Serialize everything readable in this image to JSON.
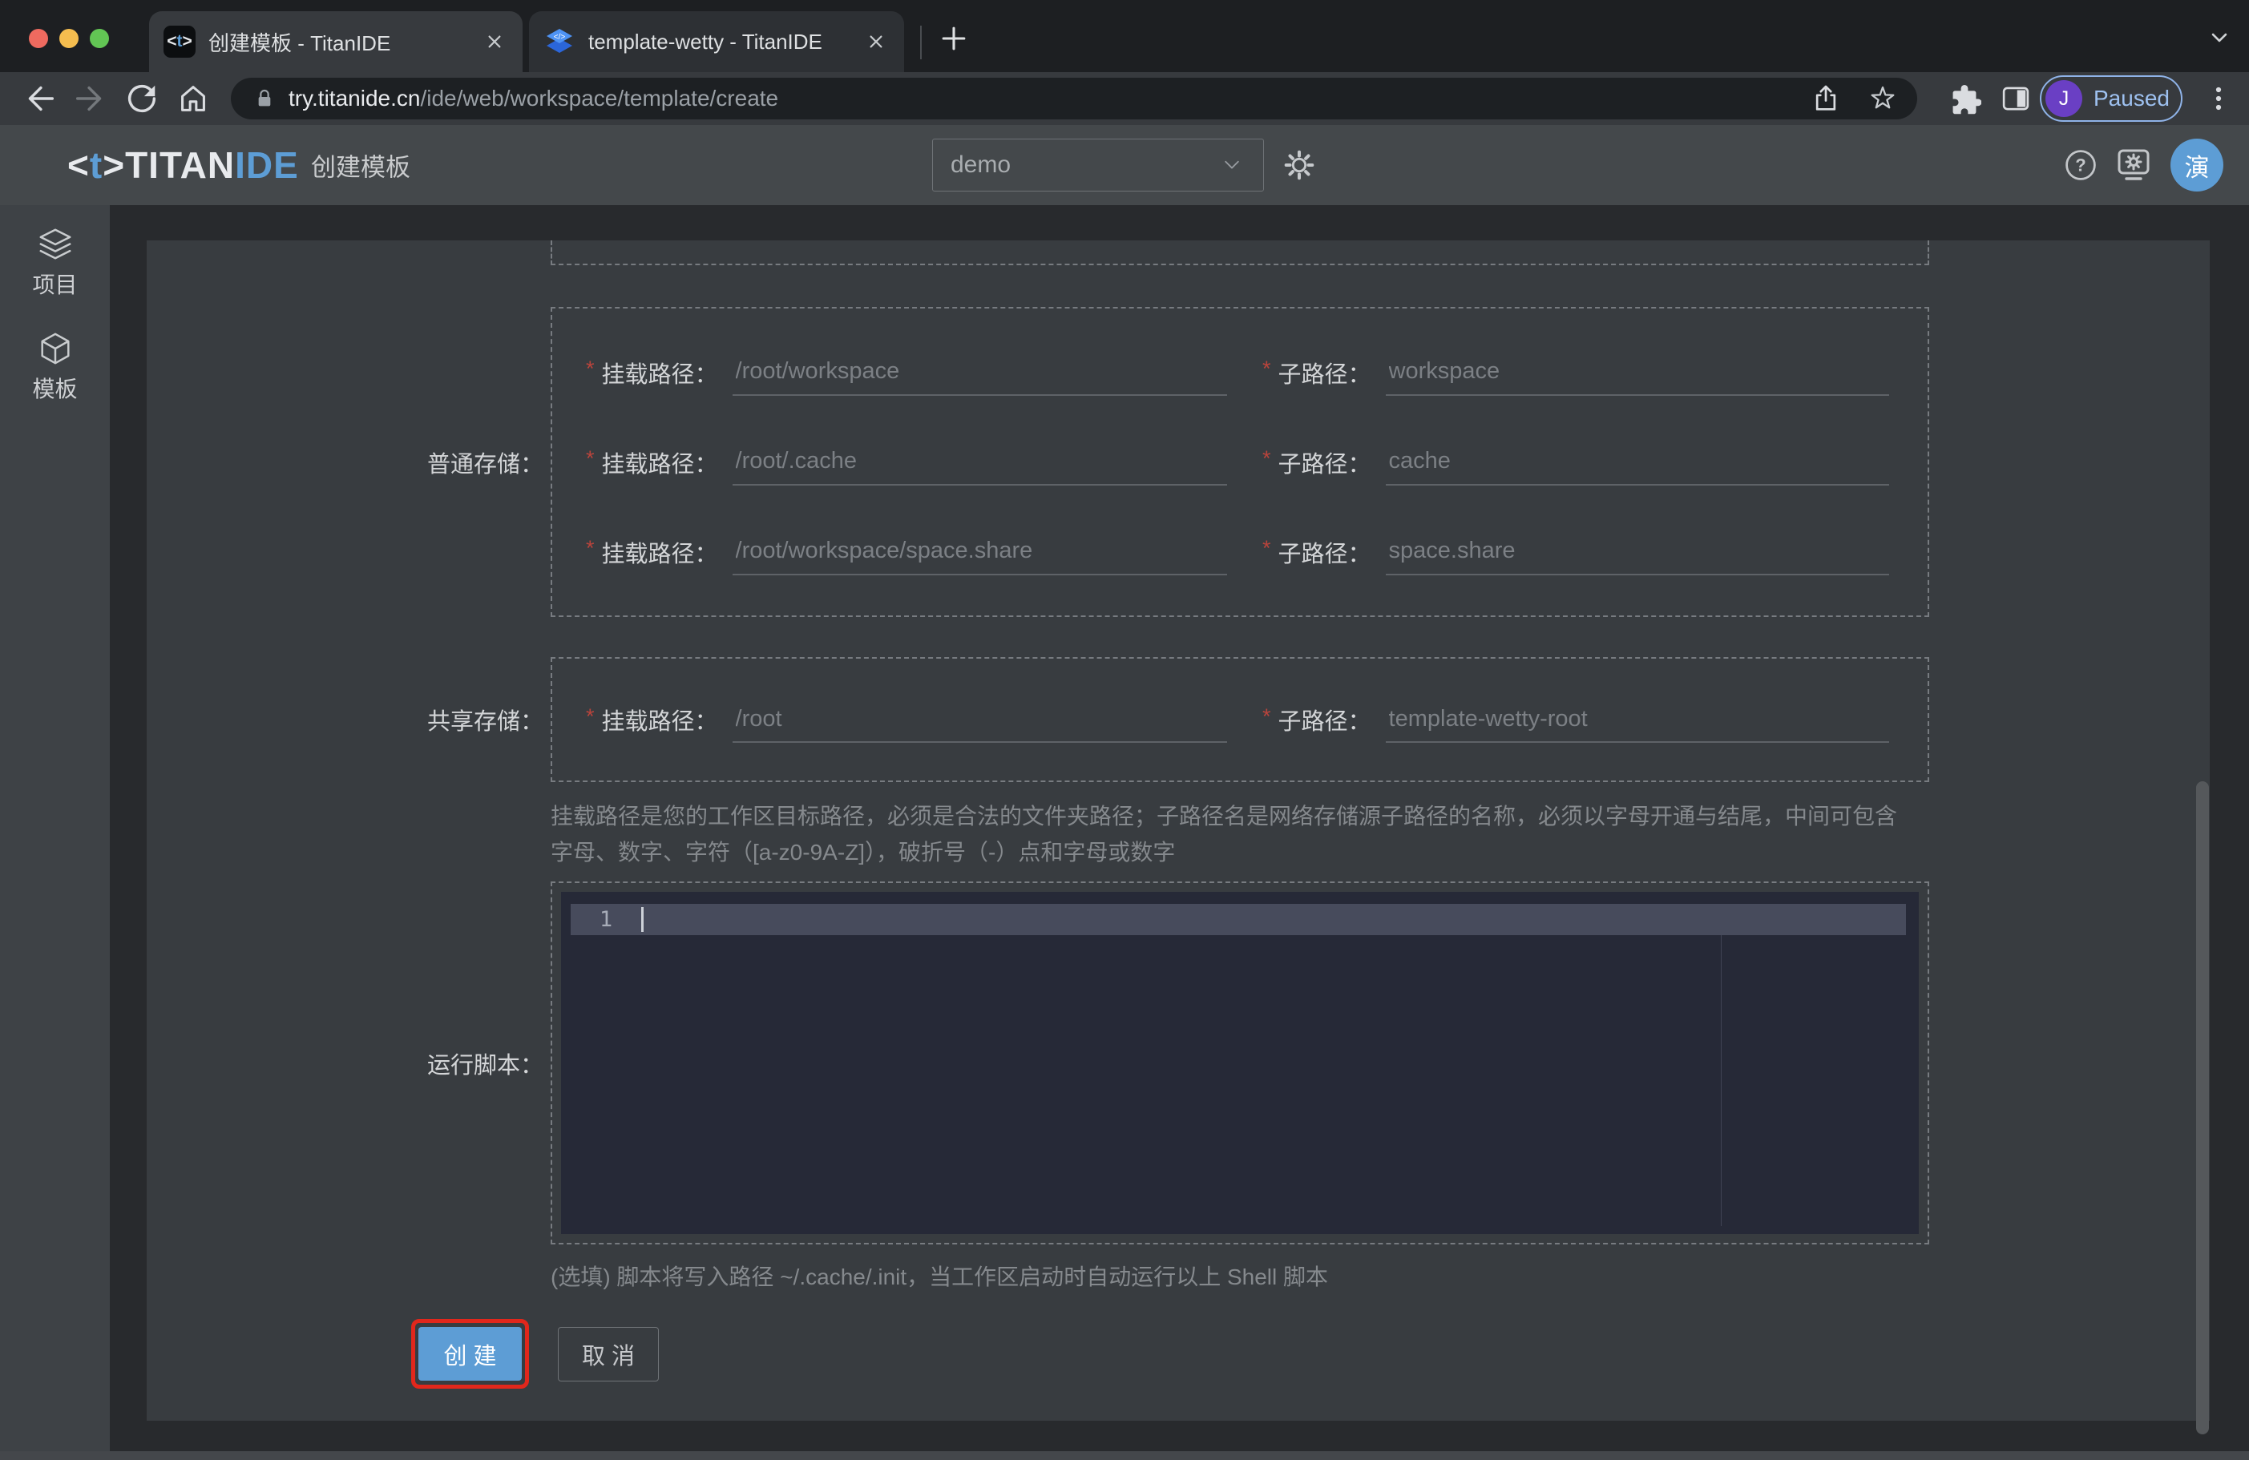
{
  "browser": {
    "tabs": [
      {
        "title": "创建模板 - TitanIDE"
      },
      {
        "title": "template-wetty - TitanIDE"
      }
    ],
    "favicon1": {
      "open": "<",
      "t": "t",
      "close": ">"
    },
    "address": {
      "host": "try.titanide.cn",
      "path": "/ide/web/workspace/template/create"
    },
    "profile": {
      "initial": "J",
      "status": "Paused"
    }
  },
  "header": {
    "logo": {
      "open": "<",
      "t": "t",
      "close": ">",
      "titan": "TITAN",
      "ide": "IDE"
    },
    "page_title": "创建模板",
    "workspace_select": {
      "value": "demo"
    },
    "help_glyph": "?",
    "avatar": "演"
  },
  "sidebar": {
    "items": [
      {
        "label": "项目"
      },
      {
        "label": "模板"
      }
    ]
  },
  "form": {
    "required_marker": "*",
    "normal_storage": {
      "label": "普通存储：",
      "rows": [
        {
          "mount_label": "挂载路径：",
          "mount_placeholder": "/root/workspace",
          "sub_label": "子路径：",
          "sub_placeholder": "workspace"
        },
        {
          "mount_label": "挂载路径：",
          "mount_placeholder": "/root/.cache",
          "sub_label": "子路径：",
          "sub_placeholder": "cache"
        },
        {
          "mount_label": "挂载路径：",
          "mount_placeholder": "/root/workspace/space.share",
          "sub_label": "子路径：",
          "sub_placeholder": "space.share"
        }
      ]
    },
    "shared_storage": {
      "label": "共享存储：",
      "rows": [
        {
          "mount_label": "挂载路径：",
          "mount_placeholder": "/root",
          "sub_label": "子路径：",
          "sub_placeholder": "template-wetty-root"
        }
      ]
    },
    "path_hint": "挂载路径是您的工作区目标路径，必须是合法的文件夹路径；子路径名是网络存储源子路径的名称，必须以字母开通与结尾，中间可包含字母、数字、字符（[a-z0-9A-Z]），破折号（-）点和字母或数字",
    "script": {
      "label": "运行脚本：",
      "line_number": "1",
      "hint": "(选填) 脚本将写入路径 ~/.cache/.init，当工作区启动时自动运行以上 Shell 脚本"
    },
    "buttons": {
      "create": "创 建",
      "cancel": "取 消"
    }
  },
  "colors": {
    "accent_blue": "#5d9dd5",
    "annotation_red": "#e1271c",
    "required_red": "#b8443c",
    "avatar_purple": "#6a3fc4",
    "paused_blue": "#9ec1f0",
    "create_button_bg": "#5d9dd5"
  }
}
